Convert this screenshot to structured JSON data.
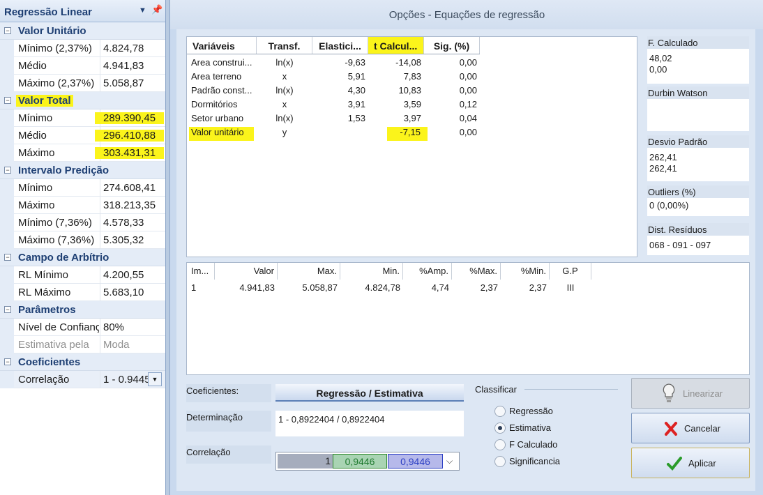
{
  "panel": {
    "title": "Regressão Linear",
    "categories": {
      "valor_unitario": {
        "label": "Valor Unitário",
        "rows": [
          {
            "k": "Mínimo (2,37%)",
            "v": "4.824,78"
          },
          {
            "k": "Médio",
            "v": "4.941,83"
          },
          {
            "k": "Máximo (2,37%)",
            "v": "5.058,87"
          }
        ]
      },
      "valor_total": {
        "label": "Valor Total",
        "rows": [
          {
            "k": "Mínimo",
            "v": "289.390,45"
          },
          {
            "k": "Médio",
            "v": "296.410,88"
          },
          {
            "k": "Máximo",
            "v": "303.431,31"
          }
        ]
      },
      "intervalo": {
        "label": "Intervalo Predição",
        "rows": [
          {
            "k": "Mínimo",
            "v": "274.608,41"
          },
          {
            "k": "Máximo",
            "v": "318.213,35"
          },
          {
            "k": "Mínimo (7,36%)",
            "v": "4.578,33"
          },
          {
            "k": "Máximo (7,36%)",
            "v": "5.305,32"
          }
        ]
      },
      "campo": {
        "label": "Campo de Arbítrio",
        "rows": [
          {
            "k": "RL Mínimo",
            "v": "4.200,55"
          },
          {
            "k": "RL Máximo",
            "v": "5.683,10"
          }
        ]
      },
      "parametros": {
        "label": "Parâmetros",
        "rows": [
          {
            "k": "Nível de Confiança",
            "v": "80%"
          },
          {
            "k": "Estimativa pela",
            "v": "Moda"
          }
        ]
      },
      "coeficientes": {
        "label": "Coeficientes",
        "rows": [
          {
            "k": "Correlação",
            "v": "1 - 0.9445"
          }
        ]
      }
    }
  },
  "dialog": {
    "title": "Opções - Equações de regressão",
    "variables_table": {
      "headers": [
        "Variáveis",
        "Transf.",
        "Elastici...",
        "t Calcul...",
        "Sig. (%)"
      ],
      "rows": [
        [
          "Area construi...",
          "ln(x)",
          "-9,63",
          "-14,08",
          "0,00"
        ],
        [
          "Area terreno",
          "x",
          "5,91",
          "7,83",
          "0,00"
        ],
        [
          "Padrão const...",
          "ln(x)",
          "4,30",
          "10,83",
          "0,00"
        ],
        [
          "Dormitórios",
          "x",
          "3,91",
          "3,59",
          "0,12"
        ],
        [
          "Setor urbano",
          "ln(x)",
          "1,53",
          "3,97",
          "0,04"
        ],
        [
          "Valor unitário",
          "y",
          "",
          "-7,15",
          "0,00"
        ]
      ]
    },
    "stats": {
      "f_calculado": {
        "label": "F. Calculado",
        "values": [
          "48,02",
          "0,00"
        ]
      },
      "durbin_watson": {
        "label": "Durbin Watson",
        "values": []
      },
      "desvio_padrao": {
        "label": "Desvio Padrão",
        "values": [
          "262,41",
          "262,41"
        ]
      },
      "outliers": {
        "label": "Outliers (%)",
        "values": [
          "0  (0,00%)"
        ]
      },
      "dist_residuos": {
        "label": "Dist. Resíduos",
        "values": [
          "068 - 091 - 097"
        ]
      }
    },
    "estimate_table": {
      "headers": [
        "Im...",
        "Valor",
        "Max.",
        "Min.",
        "%Amp.",
        "%Max.",
        "%Min.",
        "G.P"
      ],
      "rows": [
        [
          "1",
          "4.941,83",
          "5.058,87",
          "4.824,78",
          "4,74",
          "2,37",
          "2,37",
          "III"
        ]
      ]
    },
    "coeficientes_label": "Coeficientes:",
    "coeficientes_tab": "Regressão / Estimativa",
    "determinacao_label": "Determinação",
    "determinacao_value": "1 -  0,8922404  /  0,8922404",
    "correlacao_label": "Correlação",
    "correlacao_values": [
      "1",
      "0,9446",
      "0,9446"
    ],
    "classificar": {
      "label": "Classificar",
      "options": [
        "Regressão",
        "Estimativa",
        "F Calculado",
        "Significancia"
      ],
      "selected": "Estimativa"
    },
    "buttons": {
      "linearizar": "Linearizar",
      "cancelar": "Cancelar",
      "aplicar": "Aplicar"
    }
  },
  "colors": {
    "highlight": "#fbf41b",
    "header_blue": "#1e3f73",
    "green_cell": "#2f8a2f",
    "blue_cell": "#2c3fc4"
  }
}
